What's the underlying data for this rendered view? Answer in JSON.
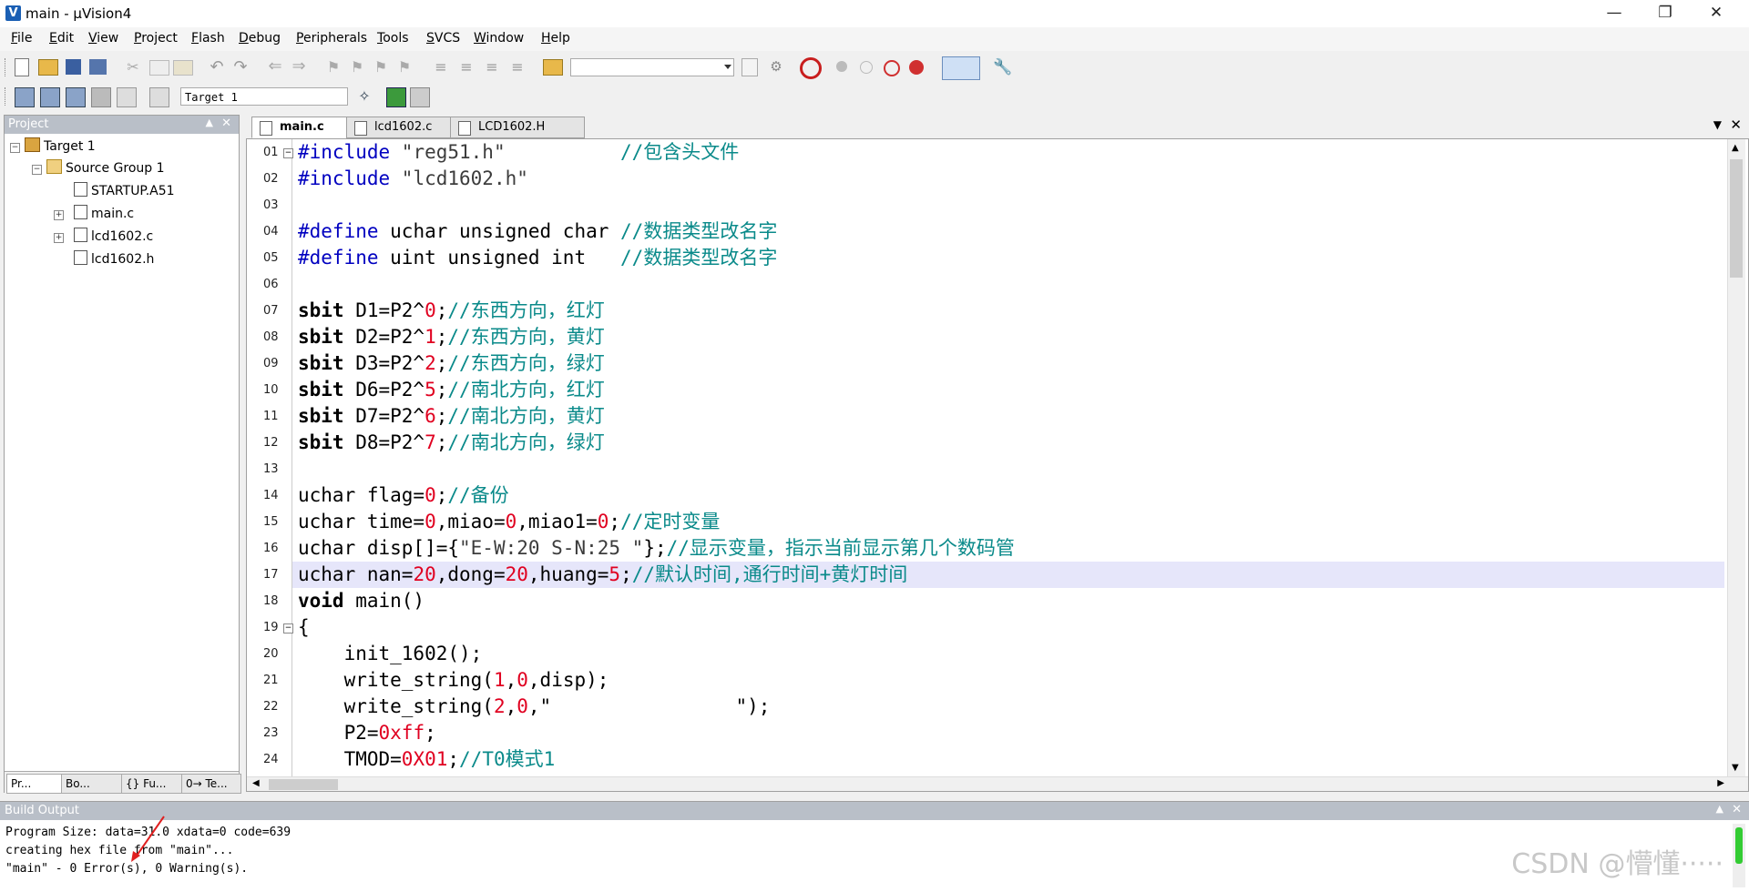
{
  "window": {
    "title": "main - µVision4",
    "app_icon": "V"
  },
  "menu": [
    "File",
    "Edit",
    "View",
    "Project",
    "Flash",
    "Debug",
    "Peripherals",
    "Tools",
    "SVCS",
    "Window",
    "Help"
  ],
  "toolbar2": {
    "target_select": "Target 1"
  },
  "project_panel": {
    "header": "Project",
    "tree": {
      "target": "Target 1",
      "group": "Source Group 1",
      "files": [
        "STARTUP.A51",
        "main.c",
        "lcd1602.c",
        "lcd1602.h"
      ]
    },
    "tabs": [
      "Pr...",
      "Bo...",
      "{} Fu...",
      "0→ Te..."
    ]
  },
  "editor": {
    "tabs": [
      "main.c",
      "lcd1602.c",
      "LCD1602.H"
    ],
    "line_numbers": [
      "01",
      "02",
      "03",
      "04",
      "05",
      "06",
      "07",
      "08",
      "09",
      "10",
      "11",
      "12",
      "13",
      "14",
      "15",
      "16",
      "17",
      "18",
      "19",
      "20",
      "21",
      "22",
      "23",
      "24"
    ],
    "lines": [
      [
        {
          "t": "#include ",
          "c": "p"
        },
        {
          "t": "\"reg51.h\"",
          "c": "s"
        },
        {
          "t": "          //包含头文件",
          "c": "c"
        }
      ],
      [
        {
          "t": "#include ",
          "c": "p"
        },
        {
          "t": "\"lcd1602.h\"",
          "c": "s"
        }
      ],
      [],
      [
        {
          "t": "#define ",
          "c": "p"
        },
        {
          "t": "uchar unsigned char ",
          "c": ""
        },
        {
          "t": "//数据类型改名字",
          "c": "c"
        }
      ],
      [
        {
          "t": "#define ",
          "c": "p"
        },
        {
          "t": "uint unsigned int   ",
          "c": ""
        },
        {
          "t": "//数据类型改名字",
          "c": "c"
        }
      ],
      [],
      [
        {
          "t": "sbit",
          "c": "k"
        },
        {
          "t": " D1=P2^",
          "c": ""
        },
        {
          "t": "0",
          "c": "n"
        },
        {
          "t": ";",
          "c": ""
        },
        {
          "t": "//东西方向，红灯",
          "c": "c"
        }
      ],
      [
        {
          "t": "sbit",
          "c": "k"
        },
        {
          "t": " D2=P2^",
          "c": ""
        },
        {
          "t": "1",
          "c": "n"
        },
        {
          "t": ";",
          "c": ""
        },
        {
          "t": "//东西方向，黄灯",
          "c": "c"
        }
      ],
      [
        {
          "t": "sbit",
          "c": "k"
        },
        {
          "t": " D3=P2^",
          "c": ""
        },
        {
          "t": "2",
          "c": "n"
        },
        {
          "t": ";",
          "c": ""
        },
        {
          "t": "//东西方向，绿灯",
          "c": "c"
        }
      ],
      [
        {
          "t": "sbit",
          "c": "k"
        },
        {
          "t": " D6=P2^",
          "c": ""
        },
        {
          "t": "5",
          "c": "n"
        },
        {
          "t": ";",
          "c": ""
        },
        {
          "t": "//南北方向，红灯",
          "c": "c"
        }
      ],
      [
        {
          "t": "sbit",
          "c": "k"
        },
        {
          "t": " D7=P2^",
          "c": ""
        },
        {
          "t": "6",
          "c": "n"
        },
        {
          "t": ";",
          "c": ""
        },
        {
          "t": "//南北方向，黄灯",
          "c": "c"
        }
      ],
      [
        {
          "t": "sbit",
          "c": "k"
        },
        {
          "t": " D8=P2^",
          "c": ""
        },
        {
          "t": "7",
          "c": "n"
        },
        {
          "t": ";",
          "c": ""
        },
        {
          "t": "//南北方向，绿灯",
          "c": "c"
        }
      ],
      [],
      [
        {
          "t": "uchar flag=",
          "c": ""
        },
        {
          "t": "0",
          "c": "n"
        },
        {
          "t": ";",
          "c": ""
        },
        {
          "t": "//备份",
          "c": "c"
        }
      ],
      [
        {
          "t": "uchar time=",
          "c": ""
        },
        {
          "t": "0",
          "c": "n"
        },
        {
          "t": ",miao=",
          "c": ""
        },
        {
          "t": "0",
          "c": "n"
        },
        {
          "t": ",miao1=",
          "c": ""
        },
        {
          "t": "0",
          "c": "n"
        },
        {
          "t": ";",
          "c": ""
        },
        {
          "t": "//定时变量",
          "c": "c"
        }
      ],
      [
        {
          "t": "uchar disp[]={",
          "c": ""
        },
        {
          "t": "\"E-W:20 S-N:25 \"",
          "c": "s"
        },
        {
          "t": "};",
          "c": ""
        },
        {
          "t": "//显示变量，指示当前显示第几个数码管",
          "c": "c"
        }
      ],
      [
        {
          "t": "uchar nan=",
          "c": ""
        },
        {
          "t": "20",
          "c": "n"
        },
        {
          "t": ",dong=",
          "c": ""
        },
        {
          "t": "20",
          "c": "n"
        },
        {
          "t": ",huang=",
          "c": ""
        },
        {
          "t": "5",
          "c": "n"
        },
        {
          "t": ";",
          "c": ""
        },
        {
          "t": "//默认时间,通行时间+黄灯时间",
          "c": "c"
        }
      ],
      [
        {
          "t": "void",
          "c": "k"
        },
        {
          "t": " main()",
          "c": ""
        }
      ],
      [
        {
          "t": "{",
          "c": ""
        }
      ],
      [
        {
          "t": "    init_1602",
          "c": ""
        },
        {
          "t": "();",
          "c": ""
        }
      ],
      [
        {
          "t": "    write_string(",
          "c": ""
        },
        {
          "t": "1",
          "c": "n"
        },
        {
          "t": ",",
          "c": ""
        },
        {
          "t": "0",
          "c": "n"
        },
        {
          "t": ",disp);",
          "c": ""
        }
      ],
      [
        {
          "t": "    write_string(",
          "c": ""
        },
        {
          "t": "2",
          "c": "n"
        },
        {
          "t": ",",
          "c": ""
        },
        {
          "t": "0",
          "c": "n"
        },
        {
          "t": ",\"                \");",
          "c": ""
        }
      ],
      [
        {
          "t": "    P2=",
          "c": ""
        },
        {
          "t": "0xff",
          "c": "n"
        },
        {
          "t": ";",
          "c": ""
        }
      ],
      [
        {
          "t": "    TMOD=",
          "c": ""
        },
        {
          "t": "0X01",
          "c": "n"
        },
        {
          "t": ";",
          "c": ""
        },
        {
          "t": "//T0模式1",
          "c": "c"
        }
      ]
    ]
  },
  "build_output": {
    "header": "Build Output",
    "lines": [
      "Program Size: data=31.0 xdata=0 code=639",
      "creating hex file from \"main\"...",
      "\"main\" - 0 Error(s), 0 Warning(s)."
    ]
  },
  "watermark": "CSDN @懵懂·····"
}
